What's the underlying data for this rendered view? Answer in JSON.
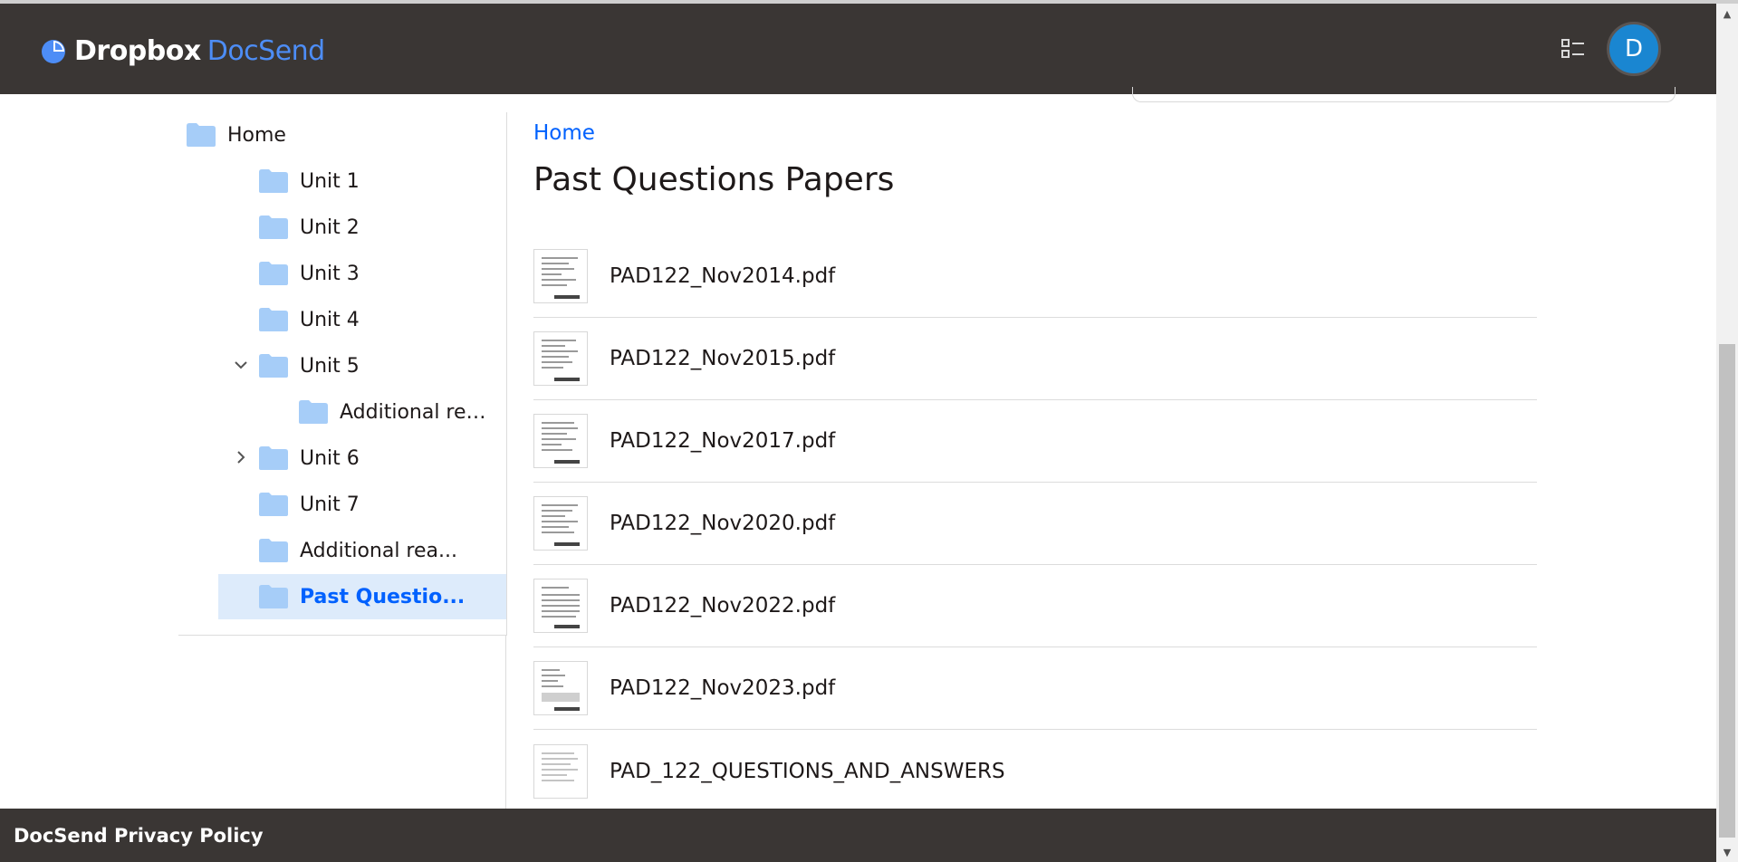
{
  "header": {
    "brand_primary": "Dropbox",
    "brand_secondary": "DocSend",
    "brand_color": "#0061fe",
    "view_toggle_icon": "list-view-icon",
    "avatar_initial": "D",
    "avatar_color": "#1a86d1"
  },
  "sidebar": {
    "items": [
      {
        "label": "Home",
        "icon": "folder-icon"
      },
      {
        "label": "Unit 1",
        "icon": "folder-icon"
      },
      {
        "label": "Unit 2",
        "icon": "folder-icon"
      },
      {
        "label": "Unit 3",
        "icon": "folder-icon"
      },
      {
        "label": "Unit 4",
        "icon": "folder-icon"
      },
      {
        "label": "Unit 5",
        "icon": "folder-icon",
        "expanded": true
      },
      {
        "label": "Additional rea...",
        "icon": "folder-icon"
      },
      {
        "label": "Unit 6",
        "icon": "folder-icon",
        "expanded": false
      },
      {
        "label": "Unit 7",
        "icon": "folder-icon"
      },
      {
        "label": "Additional rea...",
        "icon": "folder-icon"
      },
      {
        "label": "Past Questio...",
        "icon": "folder-icon",
        "selected": true
      }
    ]
  },
  "main": {
    "breadcrumb": "Home",
    "title": "Past Questions Papers",
    "files": [
      {
        "name": "PAD122_Nov2014.pdf"
      },
      {
        "name": "PAD122_Nov2015.pdf"
      },
      {
        "name": "PAD122_Nov2017.pdf"
      },
      {
        "name": "PAD122_Nov2020.pdf"
      },
      {
        "name": "PAD122_Nov2022.pdf"
      },
      {
        "name": "PAD122_Nov2023.pdf"
      },
      {
        "name": "PAD_122_QUESTIONS_AND_ANSWERS"
      }
    ]
  },
  "footer": {
    "privacy_link": "DocSend Privacy Policy"
  }
}
